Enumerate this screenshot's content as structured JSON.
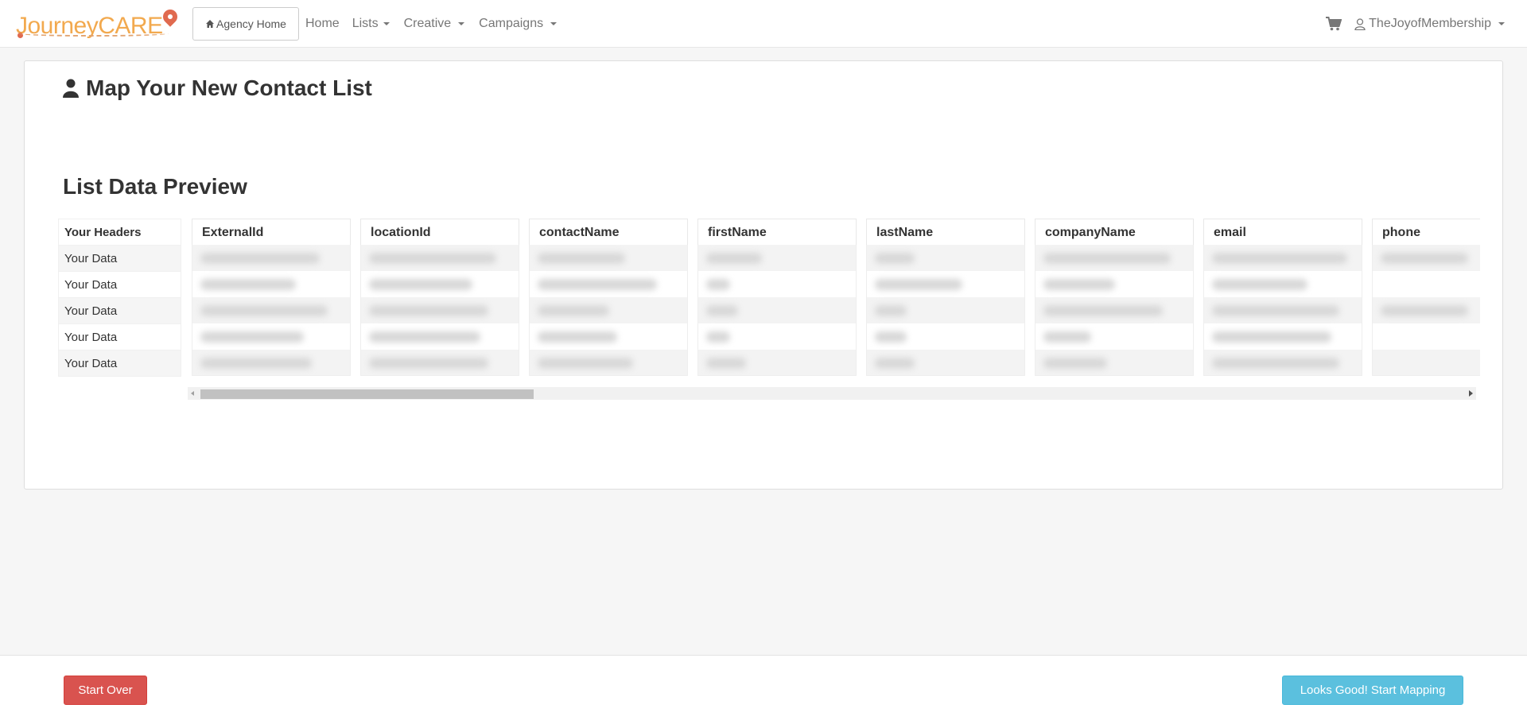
{
  "navbar": {
    "logo_text": "JourneyCARE",
    "agency_home": "Agency Home",
    "links": [
      {
        "label": "Home"
      },
      {
        "label": "Lists"
      },
      {
        "label": "Creative"
      },
      {
        "label": "Campaigns"
      }
    ],
    "user": "TheJoyofMembership",
    "colors": {
      "logo": "#f2a94e",
      "pin": "#e06a4f"
    }
  },
  "page": {
    "title": "Map Your New Contact List",
    "section_title": "List Data Preview"
  },
  "preview": {
    "header_label": "Your Headers",
    "row_labels": [
      "Your Data",
      "Your Data",
      "Your Data",
      "Your Data",
      "Your Data"
    ],
    "columns": [
      "ExternalId",
      "locationId",
      "contactName",
      "firstName",
      "lastName",
      "companyName",
      "email",
      "phone"
    ]
  },
  "footer": {
    "start_over": "Start Over",
    "start_mapping": "Looks Good! Start Mapping",
    "colors": {
      "danger": "#d9534f",
      "info": "#5bc0de"
    }
  }
}
